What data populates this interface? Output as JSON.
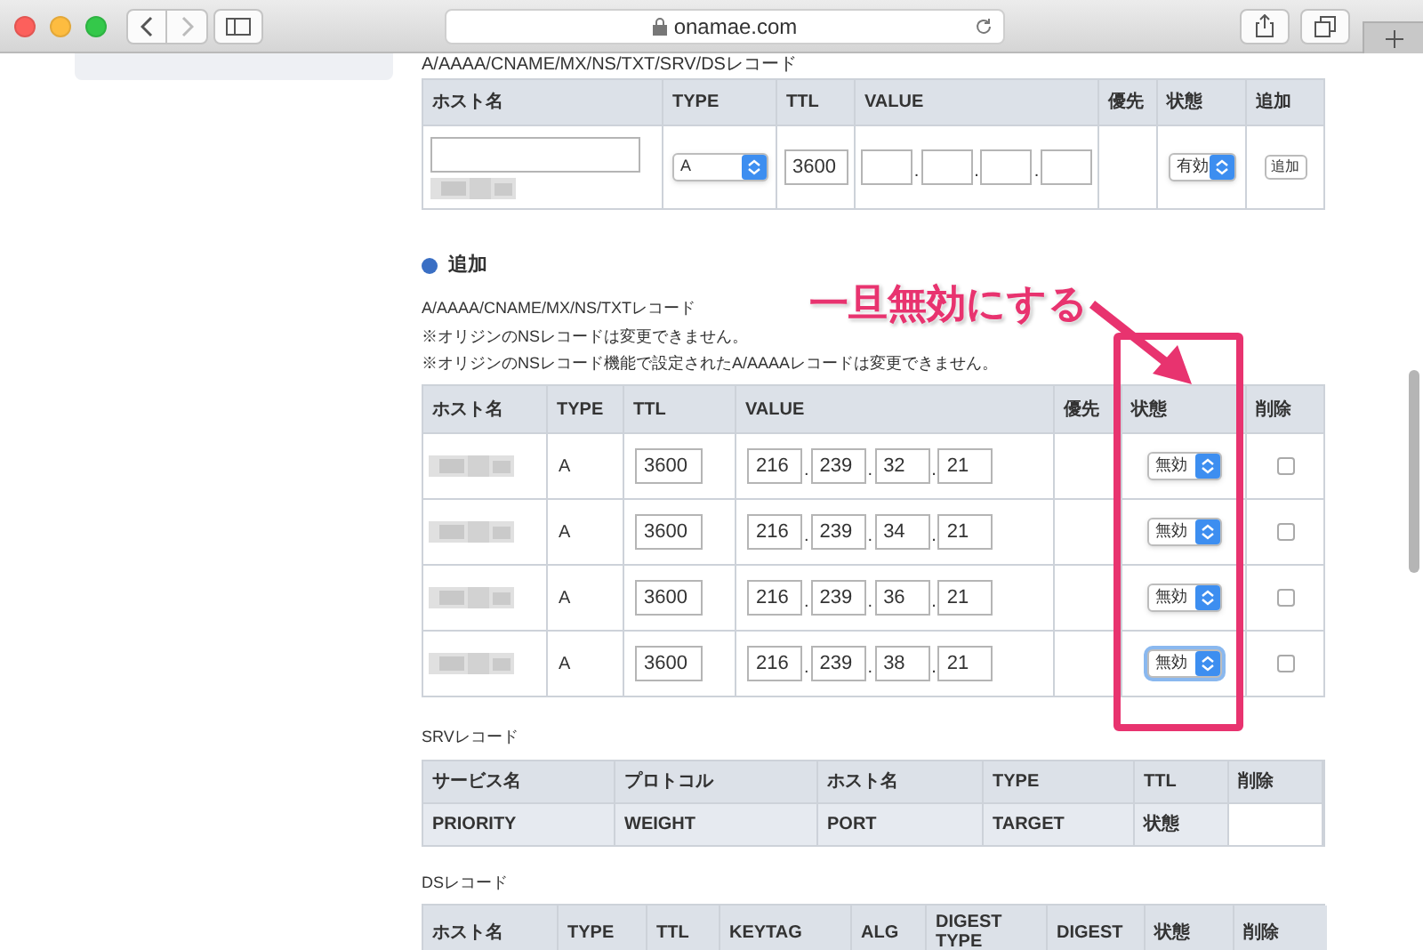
{
  "browser": {
    "url": "onamae.com"
  },
  "top_section": {
    "heading": "A/AAAA/CNAME/MX/NS/TXT/SRV/DSレコード",
    "columns": [
      "ホスト名",
      "TYPE",
      "TTL",
      "VALUE",
      "優先",
      "状態",
      "追加"
    ],
    "row": {
      "type": "A",
      "ttl": "3600",
      "value_separators": [
        ".",
        ".",
        "."
      ],
      "status": "有効",
      "add_button": "追加"
    }
  },
  "add_section": {
    "title": "追加",
    "subtitle": "A/AAAA/CNAME/MX/NS/TXTレコード",
    "notes": [
      "※オリジンのNSレコードは変更できません。",
      "※オリジンのNSレコード機能で設定されたA/AAAAレコードは変更できません。"
    ],
    "columns": [
      "ホスト名",
      "TYPE",
      "TTL",
      "VALUE",
      "優先",
      "状態",
      "削除"
    ],
    "value_separator": ".",
    "rows": [
      {
        "type": "A",
        "ttl": "3600",
        "value": [
          "216",
          "239",
          "32",
          "21"
        ],
        "status": "無効",
        "focused": false,
        "checked": false
      },
      {
        "type": "A",
        "ttl": "3600",
        "value": [
          "216",
          "239",
          "34",
          "21"
        ],
        "status": "無効",
        "focused": false,
        "checked": false
      },
      {
        "type": "A",
        "ttl": "3600",
        "value": [
          "216",
          "239",
          "36",
          "21"
        ],
        "status": "無効",
        "focused": false,
        "checked": false
      },
      {
        "type": "A",
        "ttl": "3600",
        "value": [
          "216",
          "239",
          "38",
          "21"
        ],
        "status": "無効",
        "focused": true,
        "checked": false
      }
    ]
  },
  "annotation": {
    "text": "一旦無効にする"
  },
  "srv_section": {
    "heading": "SRVレコード",
    "header_rows": [
      [
        "サービス名",
        "プロトコル",
        "ホスト名",
        "TYPE",
        "TTL",
        "削除"
      ],
      [
        "PRIORITY",
        "WEIGHT",
        "PORT",
        "TARGET",
        "状態"
      ]
    ]
  },
  "ds_section": {
    "heading": "DSレコード",
    "columns": [
      "ホスト名",
      "TYPE",
      "TTL",
      "KEYTAG",
      "ALG",
      "DIGEST TYPE",
      "DIGEST",
      "状態",
      "削除"
    ]
  }
}
